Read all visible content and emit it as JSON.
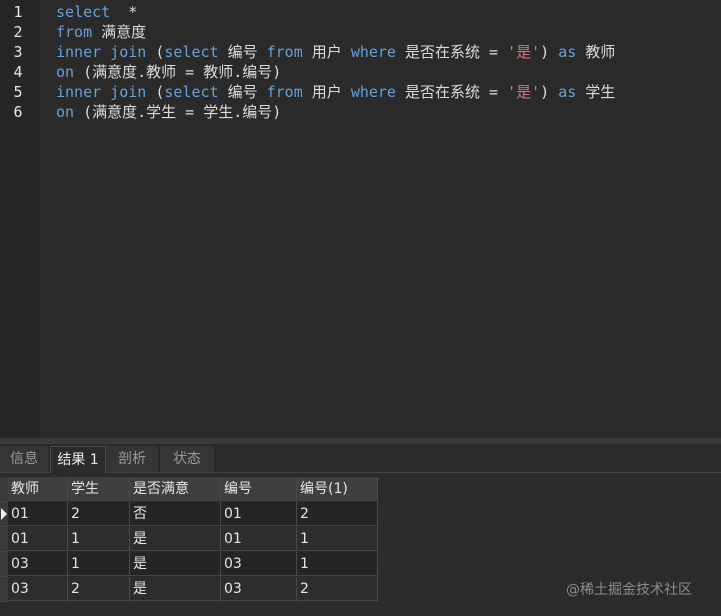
{
  "editor": {
    "lines": [
      {
        "n": "1",
        "parts": [
          [
            "kw",
            "select"
          ],
          [
            "",
            "  *"
          ]
        ]
      },
      {
        "n": "2",
        "parts": [
          [
            "kw",
            "from"
          ],
          [
            "",
            " 满意度"
          ]
        ]
      },
      {
        "n": "3",
        "parts": [
          [
            "kw",
            "inner join"
          ],
          [
            "",
            " ("
          ],
          [
            "kw",
            "select"
          ],
          [
            "",
            " 编号 "
          ],
          [
            "kw",
            "from"
          ],
          [
            "",
            " 用户 "
          ],
          [
            "kw",
            "where"
          ],
          [
            "",
            " 是否在系统 = "
          ],
          [
            "str",
            "'是'"
          ],
          [
            "",
            ") "
          ],
          [
            "kw",
            "as"
          ],
          [
            "",
            " 教师"
          ]
        ]
      },
      {
        "n": "4",
        "parts": [
          [
            "kw",
            "on"
          ],
          [
            "",
            " (满意度.教师 = 教师.编号)"
          ]
        ]
      },
      {
        "n": "5",
        "parts": [
          [
            "kw",
            "inner join"
          ],
          [
            "",
            " ("
          ],
          [
            "kw",
            "select"
          ],
          [
            "",
            " 编号 "
          ],
          [
            "kw",
            "from"
          ],
          [
            "",
            " 用户 "
          ],
          [
            "kw",
            "where"
          ],
          [
            "",
            " 是否在系统 = "
          ],
          [
            "str",
            "'是'"
          ],
          [
            "",
            ") "
          ],
          [
            "kw",
            "as"
          ],
          [
            "",
            " 学生"
          ]
        ]
      },
      {
        "n": "6",
        "parts": [
          [
            "kw",
            "on"
          ],
          [
            "",
            " (满意度.学生 = 学生.编号)"
          ]
        ]
      }
    ]
  },
  "tabs": [
    "信息",
    "结果 1",
    "剖析",
    "状态"
  ],
  "active_tab": "结果 1",
  "table": {
    "columns": [
      "教师",
      "学生",
      "是否满意",
      "编号",
      "编号(1)"
    ],
    "rows": [
      [
        "01",
        "2",
        "否",
        "01",
        "2"
      ],
      [
        "01",
        "1",
        "是",
        "01",
        "1"
      ],
      [
        "03",
        "1",
        "是",
        "03",
        "1"
      ],
      [
        "03",
        "2",
        "是",
        "03",
        "2"
      ]
    ]
  },
  "watermark": "@稀土掘金技术社区",
  "colors": {
    "keyword": "#6aa0d8",
    "string": "#e36d7a",
    "background": "#2b2b2b"
  }
}
